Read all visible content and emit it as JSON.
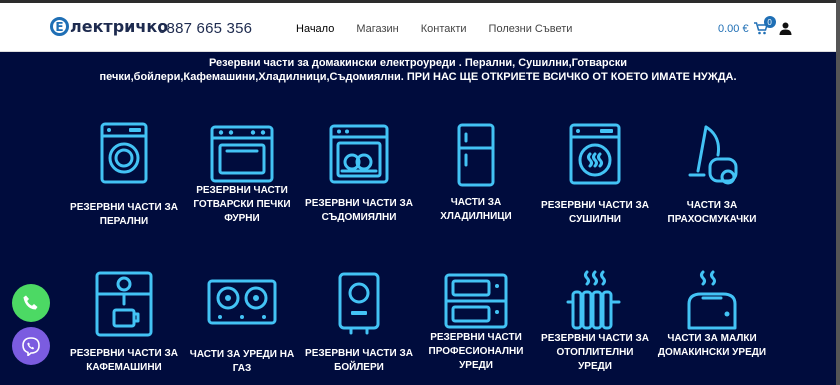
{
  "header": {
    "logo_letter": "Е",
    "logo_text": "лектричко",
    "phone": "0887 665 356",
    "nav": [
      "Начало",
      "Магазин",
      "Контакти",
      "Полезни Съвети"
    ],
    "cart_total": "0.00 €",
    "cart_count": "0"
  },
  "intro": {
    "line1": "Резервни части за домакински електроуреди .  Перални, Сушилни,Готварски",
    "line2": "печки,бойлери,Кафемашини,Хладилници,Съдомиялни. ПРИ НАС ЩЕ ОТКРИЕТЕ ВСИЧКО ОТ КОЕТО ИМАТЕ НУЖДА."
  },
  "categories": [
    {
      "icon": "washing-machine-icon",
      "label": "РЕЗЕРВНИ ЧАСТИ ЗА ПЕРАЛНИ"
    },
    {
      "icon": "oven-icon",
      "label": "РЕЗЕРВНИ ЧАСТИ ГОТВАРСКИ ПЕЧКИ ФУРНИ"
    },
    {
      "icon": "dishwasher-icon",
      "label": "РЕЗЕРВНИ ЧАСТИ ЗА СЪДОМИЯЛНИ"
    },
    {
      "icon": "fridge-icon",
      "label": "ЧАСТИ ЗА ХЛАДИЛНИЦИ"
    },
    {
      "icon": "dryer-icon",
      "label": "РЕЗЕРВНИ ЧАСТИ ЗА СУШИЛНИ"
    },
    {
      "icon": "vacuum-icon",
      "label": "ЧАСТИ ЗА ПРАХОСМУКАЧКИ"
    },
    {
      "icon": "coffee-machine-icon",
      "label": "РЕЗЕРВНИ ЧАСТИ ЗА КАФЕМАШИНИ"
    },
    {
      "icon": "hob-icon",
      "label": "ЧАСТИ ЗА УРЕДИ НА ГАЗ"
    },
    {
      "icon": "boiler-icon",
      "label": "РЕЗЕРВНИ ЧАСТИ ЗА БОЙЛЕРИ"
    },
    {
      "icon": "pro-oven-icon",
      "label": "РЕЗЕРВНИ ЧАСТИ ПРОФЕСИОНАЛНИ УРЕДИ"
    },
    {
      "icon": "radiator-icon",
      "label": "РЕЗЕРВНИ ЧАСТИ ЗА ОТОПЛИТЕЛНИ УРЕДИ"
    },
    {
      "icon": "toaster-icon",
      "label": "ЧАСТИ ЗА МАЛКИ ДОМАКИНСКИ УРЕДИ"
    }
  ],
  "colors": {
    "accent": "#1f6fb5",
    "background": "#000c3d",
    "icon": "#43c3f5",
    "call": "#4cd964",
    "viber": "#7b5ce0"
  }
}
